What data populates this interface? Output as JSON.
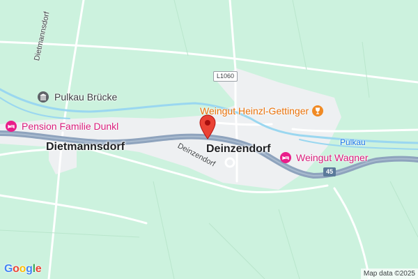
{
  "map": {
    "places": {
      "deinzendorf": "Deinzendorf",
      "dietmannsdorf": "Dietmannsdorf"
    },
    "roads": {
      "dietmannsdorf_road": "Dietmannsdorf",
      "deinzendorf_road": "Deinzendorf"
    },
    "shields": {
      "l1060": "L1060",
      "route45": "45"
    },
    "water": {
      "pulkau": "Pulkau"
    },
    "pois": {
      "pulkau_bruecke": "Pulkau Brücke",
      "pension": "Pension Familie Dunkl",
      "weingut_heinzl": "Weingut Heinzl-Gettinger",
      "weingut_wagner": "Weingut Wagner"
    },
    "icons": {
      "pin": "location-pin-icon",
      "hotel": "hotel-bed-icon",
      "winery": "wine-glass-icon",
      "landmark": "landmark-icon"
    },
    "colors": {
      "background": "#ccf2de",
      "settlement": "#eef0f2",
      "highway": "#8ea3bd",
      "river": "#9ad7f0",
      "hotel": "#e91e8a",
      "winery": "#f08a24",
      "pin": "#ea4335",
      "landmark": "#5f6368"
    }
  },
  "branding": {
    "logo_letters": [
      "G",
      "o",
      "o",
      "g",
      "l",
      "e"
    ],
    "logo_colors": [
      "#4285f4",
      "#ea4335",
      "#fbbc05",
      "#4285f4",
      "#34a853",
      "#ea4335"
    ],
    "attribution": "Map data ©2025"
  }
}
